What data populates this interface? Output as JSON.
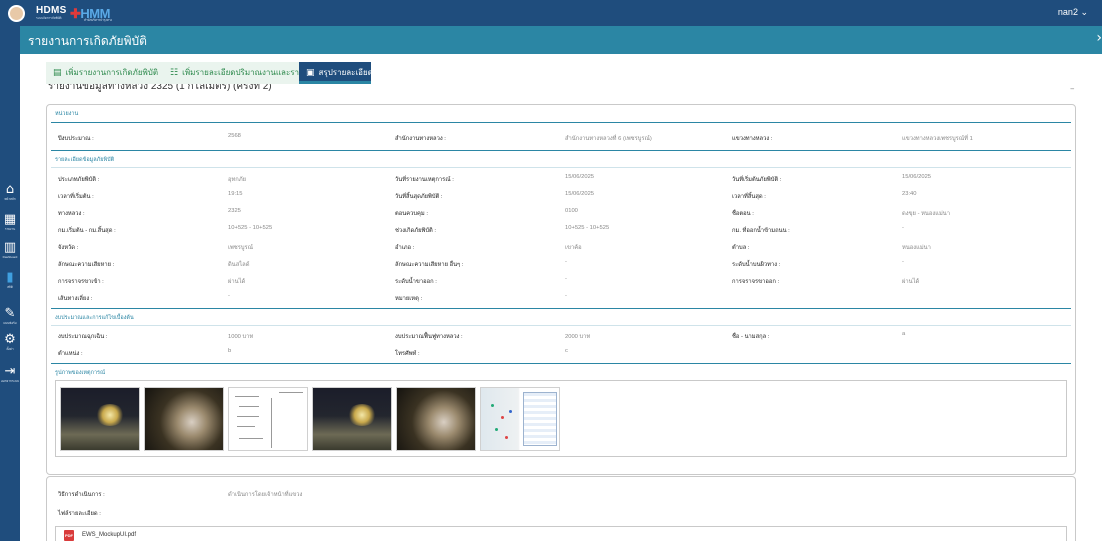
{
  "app": {
    "logo_text": "HDMS",
    "logo_subtext": "ระบบจัดการภัยพิบัติ",
    "logo_text_2": "HMM",
    "logo_subtext_2": "สำนักบริหารบำรุงทาง",
    "user_menu": "nan2 ⌄"
  },
  "sidebar": {
    "items": [
      {
        "label": "หน้าหลัก",
        "icon": "home-icon",
        "glyph": "⌂"
      },
      {
        "label": "รายงาน",
        "icon": "report-icon",
        "glyph": "▦"
      },
      {
        "label": "Dashboard",
        "icon": "chart-icon",
        "glyph": "▥"
      },
      {
        "label": "สถิติ",
        "icon": "stats-icon",
        "glyph": "▮"
      },
      {
        "label": "แบบฟอร์ม",
        "icon": "form-icon",
        "glyph": "✎"
      },
      {
        "label": "ตั้งค่า",
        "icon": "gear-icon",
        "glyph": "⚙"
      },
      {
        "label": "ออกจากระบบ",
        "icon": "logout-icon",
        "glyph": "⇥"
      }
    ]
  },
  "header": {
    "title": "รายงานการเกิดภัยพิบัติ",
    "collapse_glyph": "›"
  },
  "tabs": [
    {
      "label": "เพิ่มรายงานการเกิดภัยพิบัติ",
      "icon": "add-report-icon",
      "glyph": "▤"
    },
    {
      "label": "เพิ่มรายละเอียดปริมาณงานและราคา",
      "icon": "add-detail-icon",
      "glyph": "☷"
    },
    {
      "label": "สรุปรายละเอียด",
      "icon": "summary-icon",
      "glyph": "▣"
    }
  ],
  "report_heading": "รายงานข้อมูลทางหลวง 2325 (1 กิโลเมตร) (ครั้งที่ 2)",
  "collapse_card_glyph": "–",
  "agency": {
    "section_title": "หน่วยงาน",
    "fiscal_year_label": "ปีงบประมาณ :",
    "fiscal_year_value": "2568",
    "district_office_label": "สำนักงานทางหลวง :",
    "district_office_value": "สำนักงานทางหลวงที่ 6 (เพชรบูรณ์)",
    "highway_district_label": "แขวงทางหลวง :",
    "highway_district_value": "แขวงทางหลวงเพชรบูรณ์ที่ 1"
  },
  "disaster": {
    "section_title": "รายละเอียดข้อมูลภัยพิบัติ",
    "disaster_type_label": "ประเภทภัยพิบัติ :",
    "disaster_type_value": "อุทกภัย",
    "report_date_label": "วันที่รายงานเหตุการณ์ :",
    "report_date_value": "15/06/2025",
    "start_date_label": "วันที่เริ่มต้นภัยพิบัติ :",
    "start_date_value": "15/06/2025",
    "start_time_label": "เวลาที่เริ่มต้น :",
    "start_time_value": "19:15",
    "end_date_label": "วันที่สิ้นสุดภัยพิบัติ :",
    "end_date_value": "15/06/2025",
    "end_time_label": "เวลาที่สิ้นสุด :",
    "end_time_value": "23:40",
    "route_label": "ทางหลวง :",
    "route_value": "2325",
    "control_label": "ตอนควบคุม :",
    "control_value": "0100",
    "section_name_label": "ชื่อตอน :",
    "section_name_value": "ดงขุย - หนองแม่นา",
    "km_label": "กม.เริ่มต้น - กม.สิ้นสุด :",
    "km_value": "10+525 - 10+525",
    "disaster_range_label": "ช่วงเกิดภัยพิบัติ :",
    "disaster_range_value": "10+525 - 10+525",
    "water_km_label": "กม. ที่ออกน้ำข้ามถนน :",
    "water_km_value": "-",
    "province_label": "จังหวัด :",
    "province_value": "เพชรบูรณ์",
    "district_label": "อำเภอ :",
    "district_value": "เขาค้อ",
    "subdistrict_label": "ตำบล :",
    "subdistrict_value": "หนองแม่นา",
    "damage_type_label": "ลักษณะความเสียหาย :",
    "damage_type_value": "ดินสไลด์",
    "damage_other_label": "ลักษณะความเสียหาย อื่นๆ :",
    "damage_other_value": "-",
    "water_level_label": "ระดับน้ำบนผิวทาง :",
    "water_level_value": "-",
    "traffic_in_label": "การจราจรขาเข้า :",
    "traffic_in_value": "ผ่านได้",
    "water_out_label": "ระดับน้ำขาออก :",
    "water_out_value": "-",
    "traffic_out_label": "การจราจรขาออก :",
    "traffic_out_value": "ผ่านได้",
    "detour_label": "เส้นทางเลี่ยง :",
    "detour_value": "-",
    "remark_label": "หมายเหตุ :",
    "remark_value": "-"
  },
  "budget": {
    "section_title": "งบประมาณและการแก้ไขเบื้องต้น",
    "emergency_budget_label": "งบประมาณฉุกเฉิน :",
    "emergency_budget_value": "1000 บาท",
    "restore_budget_label": "งบประมาณฟื้นฟูทางหลวง :",
    "restore_budget_value": "2000 บาท",
    "name_label": "ชื่อ - นามสกุล :",
    "name_value": "a",
    "position_label": "ตำแหน่ง :",
    "position_value": "b",
    "phone_label": "โทรศัพท์ :",
    "phone_value": "c"
  },
  "photos": {
    "section_title": "รูปภาพของเหตุการณ์",
    "items": [
      "night-road-photo",
      "damaged-tree-photo",
      "document-scan-photo",
      "night-road-photo",
      "damaged-tree-photo",
      "map-report-photo"
    ]
  },
  "operation": {
    "method_label": "วิธีการดำเนินการ :",
    "method_value": "ดำเนินการโดยเจ้าหน้าที่แขวง",
    "file_label": "ไฟล์รายละเอียด :",
    "file_name": "EWS_MockupUI.pdf",
    "file_icon_text": "PDF"
  }
}
